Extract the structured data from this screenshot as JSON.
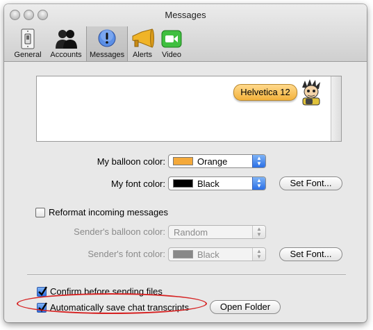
{
  "window": {
    "title": "Messages"
  },
  "toolbar": {
    "items": [
      {
        "label": "General",
        "icon": "light-switch-icon"
      },
      {
        "label": "Accounts",
        "icon": "people-icon"
      },
      {
        "label": "Messages",
        "icon": "exclamation-bubble-icon",
        "selected": true
      },
      {
        "label": "Alerts",
        "icon": "megaphone-icon"
      },
      {
        "label": "Video",
        "icon": "video-camera-icon"
      }
    ]
  },
  "preview": {
    "balloon_text": "Helvetica 12",
    "balloon_color": "#f3b23c"
  },
  "my_balloon": {
    "label": "My balloon color:",
    "value": "Orange",
    "swatch": "#f4a93a"
  },
  "my_font": {
    "label": "My font color:",
    "value": "Black",
    "swatch": "#000000",
    "button": "Set Font..."
  },
  "reformat": {
    "label": "Reformat incoming messages",
    "checked": false
  },
  "sender_balloon": {
    "label": "Sender's balloon color:",
    "value": "Random"
  },
  "sender_font": {
    "label": "Sender's font color:",
    "value": "Black",
    "swatch": "#888888",
    "button": "Set Font..."
  },
  "confirm": {
    "label": "Confirm before sending files",
    "checked": true
  },
  "autosave": {
    "label": "Automatically save chat transcripts",
    "checked": true,
    "button": "Open Folder"
  },
  "colors": {
    "accent": "#2a6ee6",
    "annotation": "#d62222"
  }
}
